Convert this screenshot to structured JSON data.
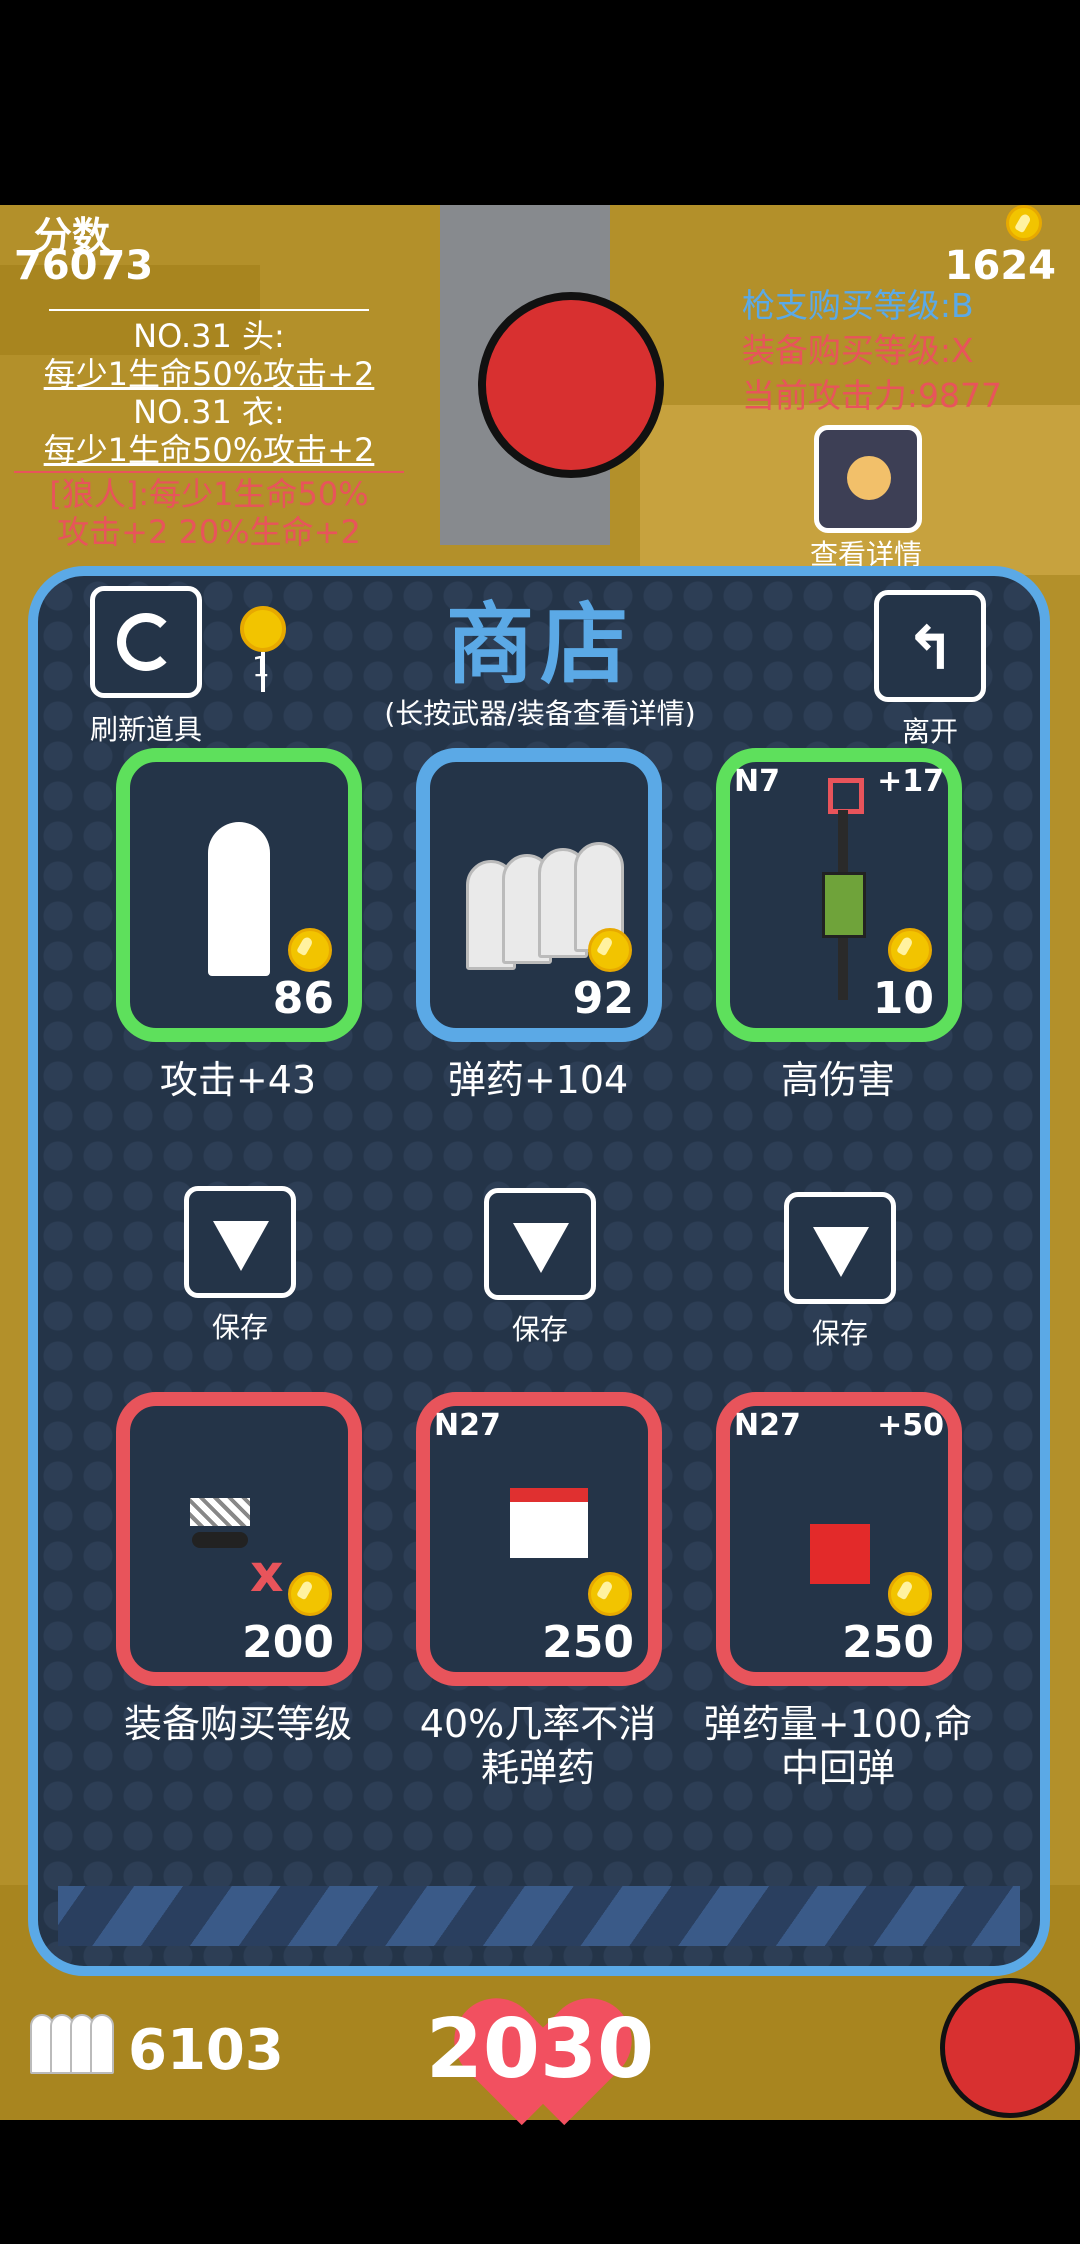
{
  "hud": {
    "score_label": "分数",
    "score_value": "76073",
    "coins_value": "1624",
    "stats": {
      "gun_level": "枪支购买等级:B",
      "equip_level": "装备购买等级:X",
      "attack_power": "当前攻击力:9877"
    },
    "buffs": {
      "head_title": "NO.31 头:",
      "head_desc": "每少1生命50%攻击+2",
      "body_title": "NO.31 衣:",
      "body_desc": "每少1生命50%攻击+2",
      "werewolf_line1": "[狼人]:每少1生命50%",
      "werewolf_line2": "攻击+2 20%生命+2"
    },
    "detail_label": "查看详情",
    "ammo_value": "6103",
    "hp_value": "2030"
  },
  "shop": {
    "title": "商店",
    "hint": "(长按武器/装备查看详情)",
    "refresh_label": "刷新道具",
    "refresh_count": "1",
    "leave_label": "离开",
    "top_items": [
      {
        "price": "86",
        "label": "攻击+43",
        "icon": "bullet-icon"
      },
      {
        "price": "92",
        "label": "弹药+104",
        "icon": "bullets-icon"
      },
      {
        "price": "10",
        "label": "高伤害",
        "icon": "rifle-icon",
        "tag": "N7",
        "plus": "+17"
      }
    ],
    "save_label": "保存",
    "bottom_items": [
      {
        "price": "200",
        "label": "装备购买等级",
        "icon": "sunglasses-icon"
      },
      {
        "price": "250",
        "label_line1": "40%几率不消",
        "label_line2": "耗弹药",
        "icon": "helmet-icon",
        "tag": "N27"
      },
      {
        "price": "250",
        "label_line1": "弹药量+100,命",
        "label_line2": "中回弹",
        "icon": "suit-icon",
        "tag": "N27",
        "plus": "+50"
      }
    ]
  },
  "colors": {
    "panel_border": "#5ba9e6",
    "green_card": "#5ee05c",
    "red_card": "#e8545b",
    "background": "#b3902a"
  }
}
